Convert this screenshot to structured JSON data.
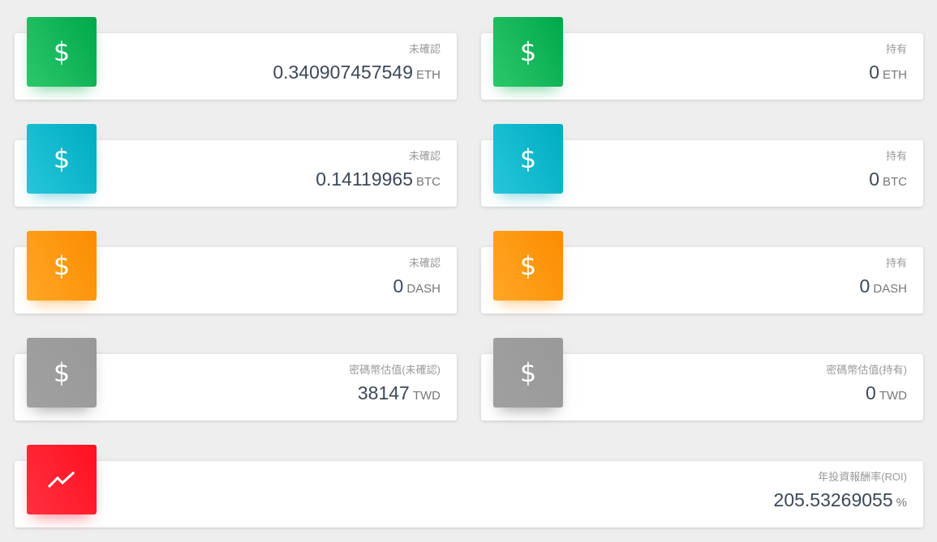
{
  "cards": [
    {
      "label": "未確認",
      "value": "0.340907457549",
      "unit": "ETH",
      "icon": "dollar-icon",
      "color": "#00a84b"
    },
    {
      "label": "持有",
      "value": "0",
      "unit": "ETH",
      "icon": "dollar-icon",
      "color": "#00a84b"
    },
    {
      "label": "未確認",
      "value": "0.14119965",
      "unit": "BTC",
      "icon": "dollar-icon",
      "color": "#00acc1"
    },
    {
      "label": "持有",
      "value": "0",
      "unit": "BTC",
      "icon": "dollar-icon",
      "color": "#00acc1"
    },
    {
      "label": "未確認",
      "value": "0",
      "unit": "DASH",
      "icon": "dollar-icon",
      "color": "#fb8c00"
    },
    {
      "label": "持有",
      "value": "0",
      "unit": "DASH",
      "icon": "dollar-icon",
      "color": "#fb8c00"
    },
    {
      "label": "密碼幣估值(未確認)",
      "value": "38147",
      "unit": "TWD",
      "icon": "dollar-icon",
      "color": "#999999"
    },
    {
      "label": "密碼幣估值(持有)",
      "value": "0",
      "unit": "TWD",
      "icon": "dollar-icon",
      "color": "#999999"
    },
    {
      "label": "年投資報酬率(ROI)",
      "value": "205.53269055",
      "unit": "%",
      "icon": "trending-up-icon",
      "color": "#ff1020"
    }
  ],
  "icons": {
    "dollar_glyph": "$"
  }
}
